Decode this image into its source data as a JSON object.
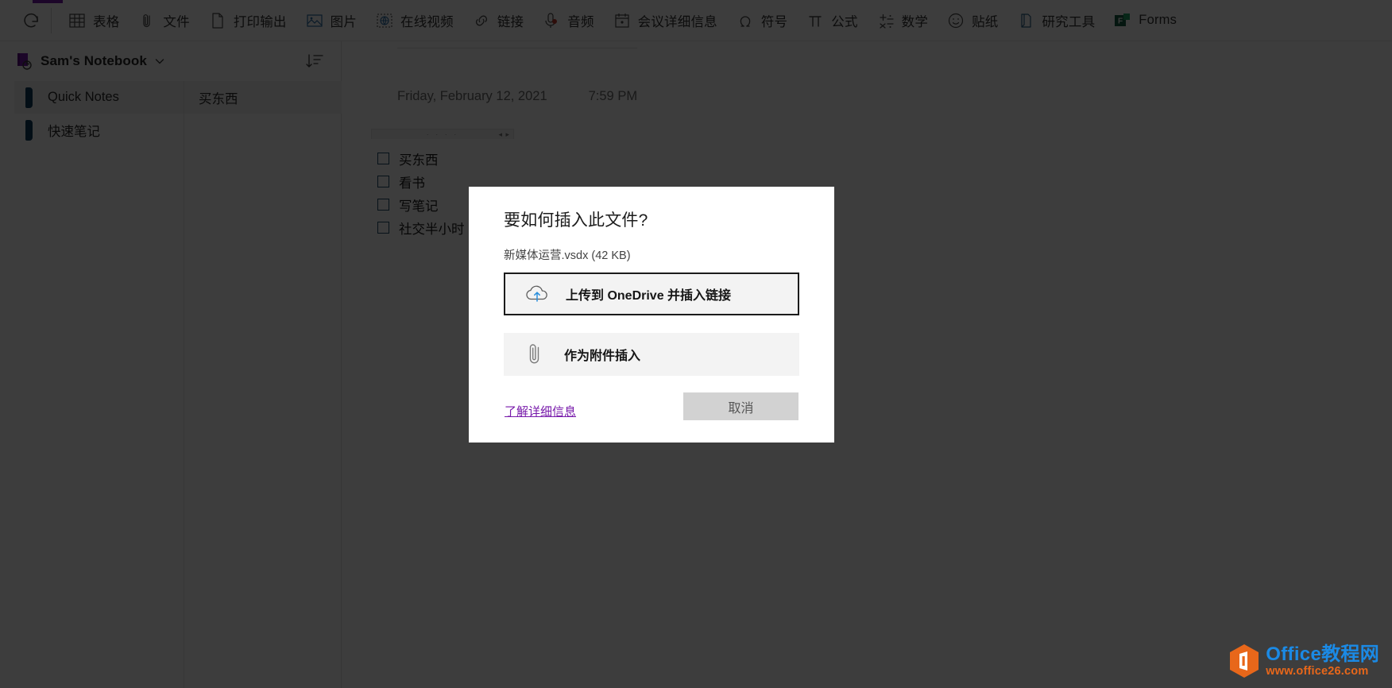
{
  "ribbon": {
    "redo_icon": "redo-icon",
    "items": [
      {
        "label": "表格",
        "icon": "table-icon"
      },
      {
        "label": "文件",
        "icon": "paperclip-icon"
      },
      {
        "label": "打印输出",
        "icon": "file-printout-icon"
      },
      {
        "label": "图片",
        "icon": "picture-icon"
      },
      {
        "label": "在线视频",
        "icon": "online-video-icon"
      },
      {
        "label": "链接",
        "icon": "link-icon"
      },
      {
        "label": "音频",
        "icon": "audio-icon"
      },
      {
        "label": "会议详细信息",
        "icon": "meeting-details-icon"
      },
      {
        "label": "符号",
        "icon": "symbol-omega-icon"
      },
      {
        "label": "公式",
        "icon": "equation-pi-icon"
      },
      {
        "label": "数学",
        "icon": "math-icon"
      },
      {
        "label": "贴纸",
        "icon": "sticker-smiley-icon"
      },
      {
        "label": "研究工具",
        "icon": "researcher-icon"
      },
      {
        "label": "Forms",
        "icon": "forms-icon"
      }
    ]
  },
  "notebook": {
    "title": "Sam's Notebook",
    "chevron_icon": "chevron-down-icon",
    "sort_icon": "sort-icon",
    "sections": [
      {
        "label": "Quick Notes",
        "selected": true
      },
      {
        "label": "快速笔记",
        "selected": false
      }
    ],
    "pages": [
      {
        "label": "买东西",
        "selected": true
      }
    ]
  },
  "canvas": {
    "date": "Friday, February 12, 2021",
    "time": "7:59 PM",
    "note_container": {
      "handle_dots": "· · · ·",
      "handle_arrows": "◂ ▸"
    },
    "todos": [
      {
        "text": "买东西",
        "checked": false
      },
      {
        "text": "看书",
        "checked": false
      },
      {
        "text": "写笔记",
        "checked": false
      },
      {
        "text": "社交半小时",
        "checked": false
      }
    ]
  },
  "dialog": {
    "title": "要如何插入此文件?",
    "subtitle": "新媒体运营.vsdx (42 KB)",
    "options": [
      {
        "label": "上传到 OneDrive 并插入链接",
        "icon": "cloud-upload-icon",
        "selected": true
      },
      {
        "label": "作为附件插入",
        "icon": "paperclip-icon",
        "selected": false
      }
    ],
    "learn_more": "了解详细信息",
    "cancel": "取消"
  },
  "watermark": {
    "logo_icon": "office-hex-logo-icon",
    "name": "Office教程网",
    "url": "www.office26.com"
  },
  "colors": {
    "accent_purple": "#7719aa",
    "section_tab": "#0f3c5e",
    "cloud_arrow_blue": "#2a8fdd",
    "watermark_blue": "#1b8ae5",
    "watermark_orange": "#e8671a",
    "dim_overlay": "rgba(0,0,0,0.76)"
  }
}
